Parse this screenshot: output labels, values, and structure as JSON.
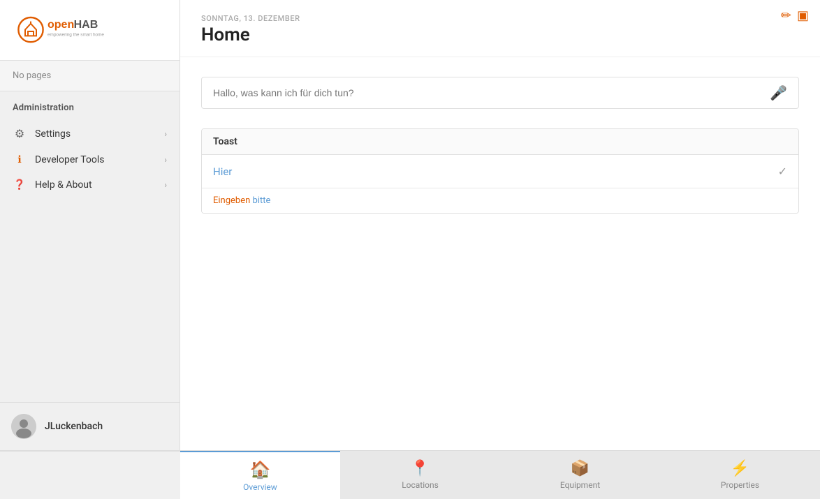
{
  "topIcons": {
    "edit": "✏",
    "layout": "▣"
  },
  "sidebar": {
    "logo": {
      "alt": "openHAB - empowering the smart home"
    },
    "noPages": "No pages",
    "adminLabel": "Administration",
    "items": [
      {
        "id": "settings",
        "label": "Settings",
        "icon": "⚙"
      },
      {
        "id": "developer-tools",
        "label": "Developer Tools",
        "icon": "⚠"
      },
      {
        "id": "help-about",
        "label": "Help & About",
        "icon": "❓"
      }
    ],
    "user": {
      "name": "JLuckenbach"
    }
  },
  "main": {
    "dateLabel": "SONNTAG, 13. DEZEMBER",
    "pageTitle": "Home",
    "search": {
      "placeholder": "Hallo, was kann ich für dich tun?"
    },
    "toast": {
      "header": "Toast",
      "item": "Hier",
      "errorPart1": "Eingeben",
      "errorPart2": "bitte"
    }
  },
  "bottomNav": {
    "items": [
      {
        "id": "overview",
        "label": "Overview",
        "icon": "🏠",
        "active": true
      },
      {
        "id": "locations",
        "label": "Locations",
        "icon": "📍",
        "active": false
      },
      {
        "id": "equipment",
        "label": "Equipment",
        "icon": "📦",
        "active": false
      },
      {
        "id": "properties",
        "label": "Properties",
        "icon": "⚡",
        "active": false
      }
    ]
  }
}
